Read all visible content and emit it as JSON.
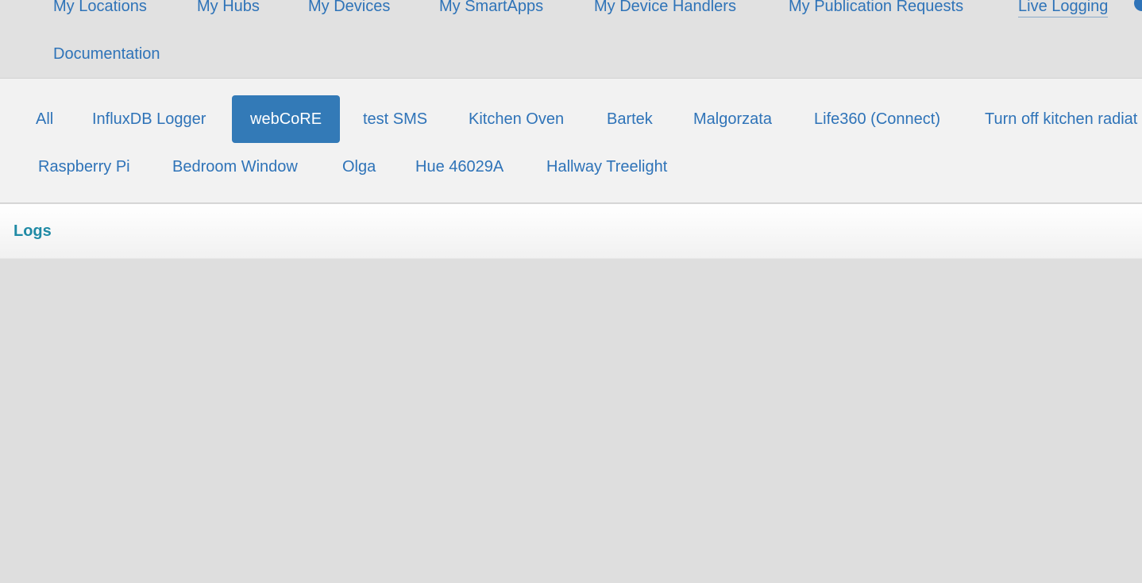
{
  "topnav": {
    "items": [
      {
        "label": "My Locations"
      },
      {
        "label": "My Hubs"
      },
      {
        "label": "My Devices"
      },
      {
        "label": "My SmartApps"
      },
      {
        "label": "My Device Handlers"
      },
      {
        "label": "My Publication Requests"
      },
      {
        "label": "Live Logging",
        "active": true
      },
      {
        "label": "Documentation"
      }
    ]
  },
  "filters": {
    "items": [
      {
        "label": "All"
      },
      {
        "label": "InfluxDB Logger"
      },
      {
        "label": "webCoRE",
        "selected": true
      },
      {
        "label": "test SMS"
      },
      {
        "label": "Kitchen Oven"
      },
      {
        "label": "Bartek"
      },
      {
        "label": "Malgorzata"
      },
      {
        "label": "Life360 (Connect)"
      },
      {
        "label": "Turn off kitchen radiat"
      },
      {
        "label": "Raspberry Pi"
      },
      {
        "label": "Bedroom Window"
      },
      {
        "label": "Olga"
      },
      {
        "label": "Hue 46029A"
      },
      {
        "label": "Hallway Treelight"
      }
    ],
    "selected_color": "#337ab7",
    "link_color": "#2e73b8"
  },
  "logs": {
    "title": "Logs"
  }
}
